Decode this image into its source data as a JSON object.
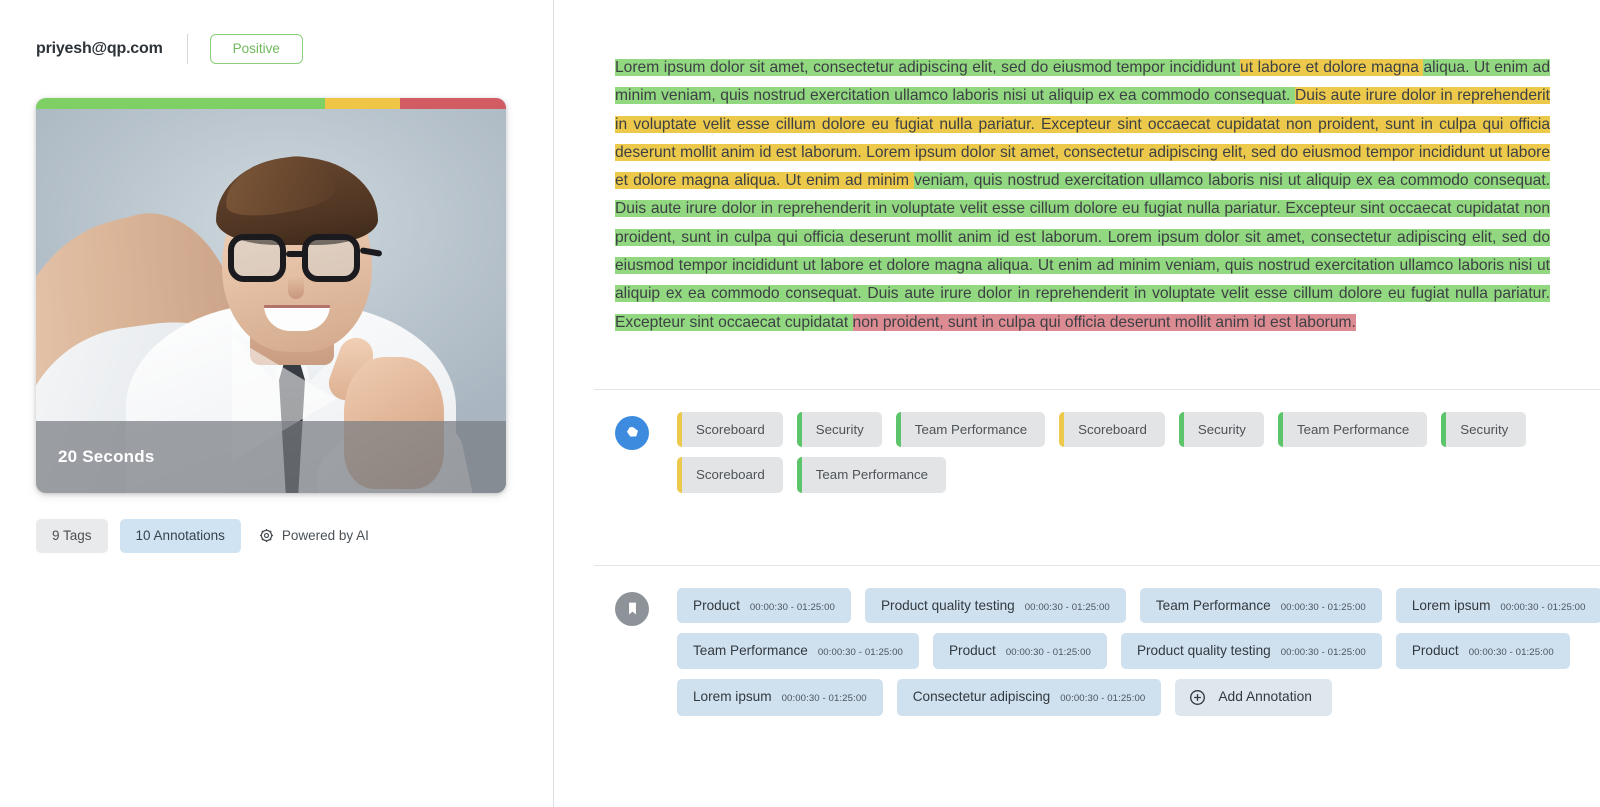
{
  "left": {
    "email": "priyesh@qp.com",
    "sentiment_label": "Positive",
    "sentiment_bar": [
      {
        "label": "positive",
        "color": "#7ed065",
        "pct": 61.5
      },
      {
        "label": "neutral",
        "color": "#efc545",
        "pct": 16.0
      },
      {
        "label": "negative",
        "color": "#d15c64",
        "pct": 22.5
      }
    ],
    "duration": "20 Seconds",
    "tags_count": "9 Tags",
    "annotations_count": "10 Annotations",
    "powered_by": "Powered by AI",
    "icons": {
      "gear": "gear-icon",
      "play": "play-icon"
    }
  },
  "transcript": {
    "segments": [
      {
        "color": "g",
        "text": "Lorem ipsum dolor sit amet, consectetur adipiscing elit, sed do eiusmod tempor incididunt "
      },
      {
        "color": "y",
        "text": "ut labore et dolore magna "
      },
      {
        "color": "g",
        "text": "aliqua. Ut enim ad minim veniam, quis nostrud exercitation ullamco laboris nisi ut aliquip ex ea commodo consequat. "
      },
      {
        "color": "y",
        "text": "Duis aute irure dolor in reprehenderit in voluptate velit esse cillum dolore eu fugiat nulla pariatur. Excepteur sint occaecat cupidatat non proident, sunt in culpa qui officia deserunt mollit anim id est laborum. Lorem ipsum dolor sit amet, consectetur adipiscing elit, sed do eiusmod tempor incididunt ut labore et dolore magna aliqua. Ut enim ad minim "
      },
      {
        "color": "g",
        "text": "veniam, quis nostrud exercitation ullamco laboris nisi ut aliquip ex ea commodo consequat. Duis aute irure dolor in reprehenderit in voluptate velit esse cillum dolore eu fugiat nulla pariatur. Excepteur sint occaecat cupidatat non proident, sunt in culpa qui officia deserunt mollit anim id est laborum. Lorem ipsum dolor sit amet, consectetur adipiscing elit, sed do eiusmod tempor incididunt ut labore et dolore magna aliqua. Ut enim ad minim veniam, quis nostrud exercitation ullamco laboris nisi ut aliquip ex ea commodo consequat. Duis aute irure dolor in reprehenderit in voluptate velit esse cillum dolore eu fugiat nulla pariatur. Excepteur sint occaecat cupidatat "
      },
      {
        "color": "r",
        "text": "non proident, sunt in culpa qui officia deserunt mollit anim id est laborum."
      }
    ]
  },
  "tags_section": {
    "icon": "tag-icon",
    "items": [
      {
        "label": "Scoreboard",
        "accent": "yellow"
      },
      {
        "label": "Security",
        "accent": "green"
      },
      {
        "label": "Team Performance",
        "accent": "green"
      },
      {
        "label": "Scoreboard",
        "accent": "yellow"
      },
      {
        "label": "Security",
        "accent": "green"
      },
      {
        "label": "Team Performance",
        "accent": "green"
      },
      {
        "label": "Security",
        "accent": "green"
      },
      {
        "label": "Scoreboard",
        "accent": "yellow"
      },
      {
        "label": "Team Performance",
        "accent": "green"
      }
    ]
  },
  "annotations_section": {
    "icon": "bookmark-icon",
    "items": [
      {
        "label": "Product",
        "time": "00:00:30 - 01:25:00"
      },
      {
        "label": "Product quality testing",
        "time": "00:00:30 - 01:25:00"
      },
      {
        "label": "Team Performance",
        "time": "00:00:30 - 01:25:00"
      },
      {
        "label": "Lorem ipsum",
        "time": "00:00:30 - 01:25:00"
      },
      {
        "label": "Team Performance",
        "time": "00:00:30 - 01:25:00"
      },
      {
        "label": "Product",
        "time": "00:00:30 - 01:25:00"
      },
      {
        "label": "Product quality testing",
        "time": "00:00:30 - 01:25:00"
      },
      {
        "label": "Product",
        "time": "00:00:30 - 01:25:00"
      },
      {
        "label": "Lorem ipsum",
        "time": "00:00:30 - 01:25:00"
      },
      {
        "label": "Consectetur adipiscing",
        "time": "00:00:30 - 01:25:00"
      }
    ],
    "add_label": "Add Annotation",
    "add_icon": "plus-circle-icon"
  },
  "colors": {
    "highlight_positive": "#92d880",
    "highlight_neutral": "#edc94b",
    "highlight_negative": "#dd8b93",
    "accent_blue": "#3d8bde",
    "accent_gray": "#8d9399"
  }
}
